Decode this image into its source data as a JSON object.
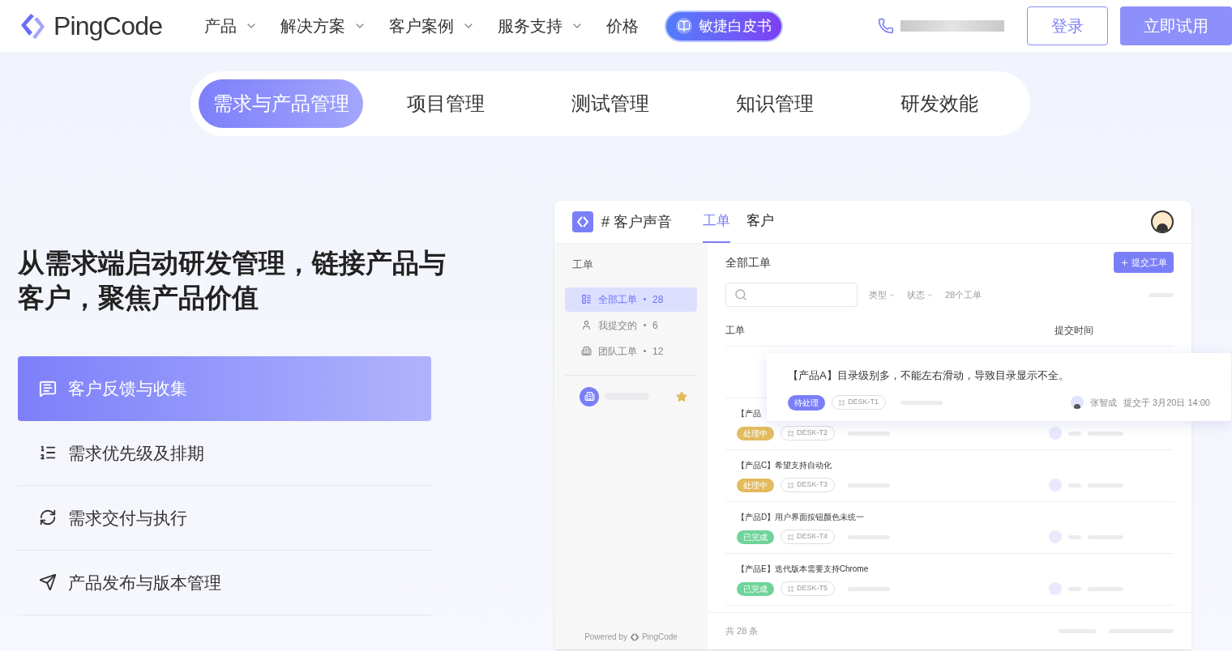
{
  "nav": {
    "logo": "PingCode",
    "items": [
      {
        "label": "产品",
        "dropdown": true
      },
      {
        "label": "解决方案",
        "dropdown": true
      },
      {
        "label": "客户案例",
        "dropdown": true
      },
      {
        "label": "服务支持",
        "dropdown": true
      },
      {
        "label": "价格",
        "dropdown": false
      }
    ],
    "badge": "敏捷白皮书",
    "login": "登录",
    "trial": "立即试用"
  },
  "tabs": [
    {
      "label": "需求与产品管理",
      "selected": true
    },
    {
      "label": "项目管理",
      "selected": false
    },
    {
      "label": "测试管理",
      "selected": false
    },
    {
      "label": "知识管理",
      "selected": false
    },
    {
      "label": "研发效能",
      "selected": false
    }
  ],
  "headline": "从需求端启动研发管理，链接产品与客户，聚焦产品价值",
  "features": [
    {
      "label": "客户反馈与收集",
      "kind": "feedback",
      "selected": true
    },
    {
      "label": "需求优先级及排期",
      "kind": "priority",
      "selected": false
    },
    {
      "label": "需求交付与执行",
      "kind": "delivery",
      "selected": false
    },
    {
      "label": "产品发布与版本管理",
      "kind": "release",
      "selected": false
    }
  ],
  "app": {
    "title": "# 客户声音",
    "tabs": [
      {
        "label": "工单",
        "selected": true
      },
      {
        "label": "客户",
        "selected": false
      }
    ],
    "sidebar": {
      "heading": "工单",
      "items": [
        {
          "label": "全部工单",
          "count": "28",
          "kind": "list",
          "selected": true
        },
        {
          "label": "我提交的",
          "count": "6",
          "kind": "user",
          "selected": false
        },
        {
          "label": "团队工单",
          "count": "12",
          "kind": "building",
          "selected": false
        }
      ],
      "powered_by": "Powered by",
      "brand": "PingCode"
    },
    "main": {
      "title": "全部工单",
      "submit": "提交工单",
      "filters": [
        "类型",
        "状态"
      ],
      "count": "28个工单",
      "columns": [
        "工单",
        "提交时间"
      ],
      "card": {
        "title": "【产品A】目录级别多，不能左右滑动，导致目录显示不全。",
        "status": "待处理",
        "color": "#7b7ff7",
        "id": "DESK-T1",
        "user": "张智成",
        "time": "提交于 3月20日 14:00"
      },
      "rows": [
        {
          "title": "【产品",
          "status": "处理中",
          "color": "#e3bb5f",
          "id": "DESK-T2"
        },
        {
          "title": "【产品C】希望支持自动化",
          "status": "处理中",
          "color": "#e3bb5f",
          "id": "DESK-T3"
        },
        {
          "title": "【产品D】用户界面按钮颜色未统一",
          "status": "已完成",
          "color": "#6fd49a",
          "id": "DESK-T4"
        },
        {
          "title": "【产品E】迭代版本需要支持Chrome",
          "status": "已完成",
          "color": "#6fd49a",
          "id": "DESK-T5"
        }
      ],
      "total": "共 28 条"
    }
  }
}
